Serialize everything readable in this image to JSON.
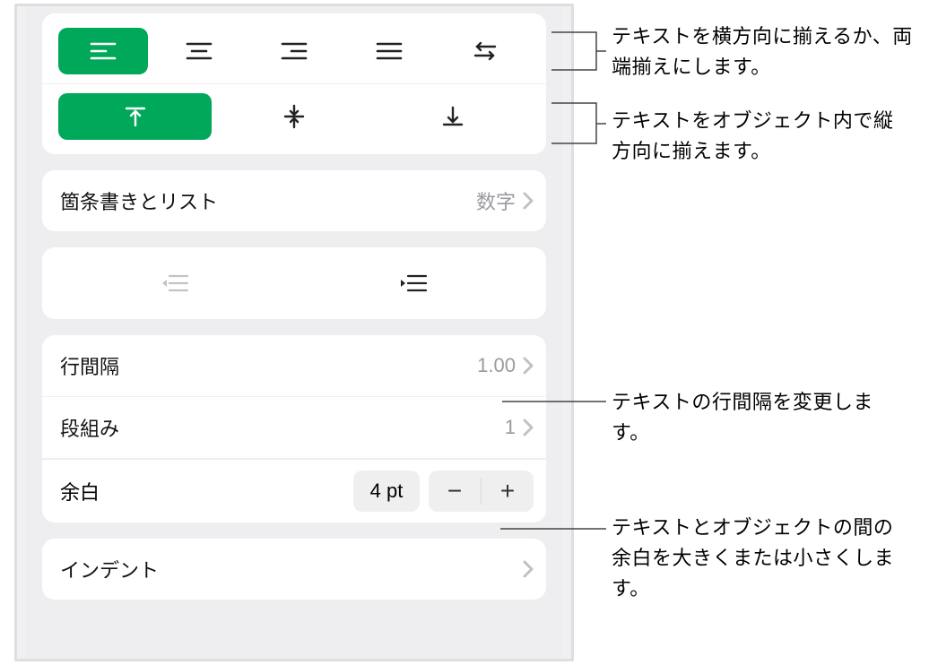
{
  "callouts": {
    "hAlign": "テキストを横方向に揃えるか、両端揃えにします。",
    "vAlign": "テキストをオブジェクト内で縦方向に揃えます。",
    "lineSpacing": "テキストの行間隔を変更します。",
    "margin": "テキストとオブジェクトの間の余白を大きくまたは小さくします。"
  },
  "bulletsAndLists": {
    "label": "箇条書きとリスト",
    "value": "数字"
  },
  "lineSpacing": {
    "label": "行間隔",
    "value": "1.00"
  },
  "columns": {
    "label": "段組み",
    "value": "1"
  },
  "margin": {
    "label": "余白",
    "value": "4 pt"
  },
  "indent": {
    "label": "インデント"
  },
  "stepper": {
    "minus": "−",
    "plus": "+"
  }
}
